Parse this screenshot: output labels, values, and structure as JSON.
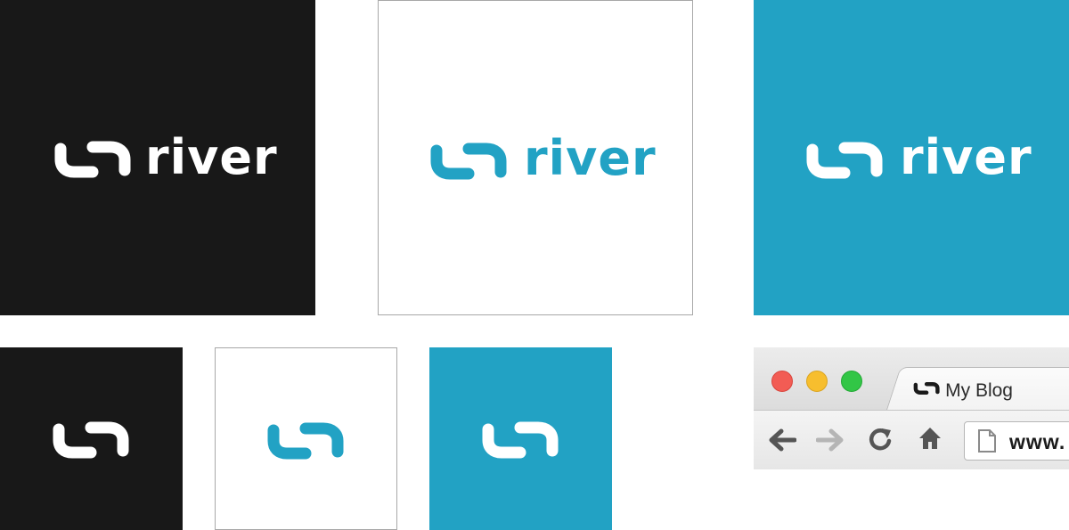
{
  "brand": {
    "wordmark": "river",
    "symbol_icon": "river-wave-icon",
    "colors": {
      "blue": "#22a2c4",
      "black": "#181818",
      "white": "#ffffff"
    }
  },
  "lockups": {
    "dark": {
      "wordmark": "river"
    },
    "light": {
      "wordmark": "river"
    },
    "blue": {
      "wordmark": "river"
    }
  },
  "browser": {
    "tab_title": "My Blog",
    "url_text": "www.",
    "traffic_lights": [
      "#f25c54",
      "#f7be2e",
      "#32c646"
    ],
    "nav_icons": [
      "back-arrow-icon",
      "forward-arrow-icon",
      "reload-icon",
      "home-icon",
      "page-icon"
    ]
  }
}
